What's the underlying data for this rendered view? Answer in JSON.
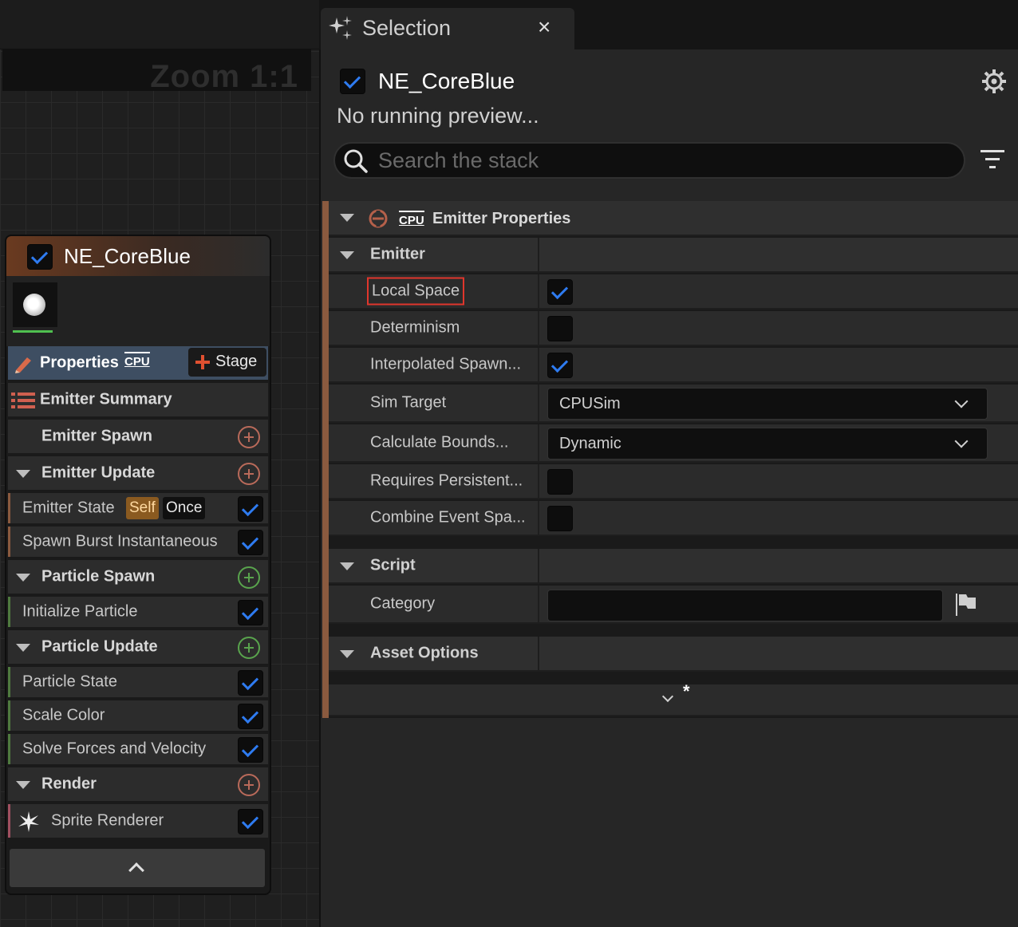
{
  "graph": {
    "zoom_label": "Zoom 1:1"
  },
  "node": {
    "title": "NE_CoreBlue",
    "enabled": true,
    "properties_label": "Properties",
    "cpu_label": "CPU",
    "stage_label": "Stage",
    "rows": [
      {
        "label": "Emitter Summary"
      },
      {
        "label": "Emitter Spawn"
      },
      {
        "label": "Emitter Update"
      },
      {
        "label": "Emitter State"
      },
      {
        "label": "Spawn Burst Instantaneous"
      },
      {
        "label": "Particle Spawn"
      },
      {
        "label": "Initialize Particle"
      },
      {
        "label": "Particle Update"
      },
      {
        "label": "Particle State"
      },
      {
        "label": "Scale Color"
      },
      {
        "label": "Solve Forces and Velocity"
      },
      {
        "label": "Render"
      },
      {
        "label": "Sprite Renderer"
      }
    ],
    "badges": {
      "self": "Self",
      "once": "Once"
    }
  },
  "tab": {
    "title": "Selection",
    "close": "×"
  },
  "panel": {
    "emitter_name": "NE_CoreBlue",
    "status": "No running preview...",
    "search_placeholder": "Search the stack",
    "section_header": "Emitter Properties",
    "cpu_label": "CPU",
    "groups": {
      "emitter": "Emitter",
      "script": "Script",
      "asset_options": "Asset Options"
    },
    "properties": [
      {
        "name": "Local Space",
        "checked": true
      },
      {
        "name": "Determinism",
        "checked": false
      },
      {
        "name": "Interpolated Spawn...",
        "checked": true
      },
      {
        "name": "Sim Target",
        "value": "CPUSim"
      },
      {
        "name": "Calculate Bounds...",
        "value": "Dynamic"
      },
      {
        "name": "Requires Persistent...",
        "checked": false
      },
      {
        "name": "Combine Event Spa...",
        "checked": false
      }
    ],
    "category_label": "Category",
    "category_value": "",
    "expand_marker": "*"
  },
  "colors": {
    "accent_orange": "#8a5a3f",
    "check_blue": "#2e7bf0",
    "plus_red": "#b96a5a",
    "plus_green": "#59a44d",
    "highlight_box": "#e0362c"
  }
}
